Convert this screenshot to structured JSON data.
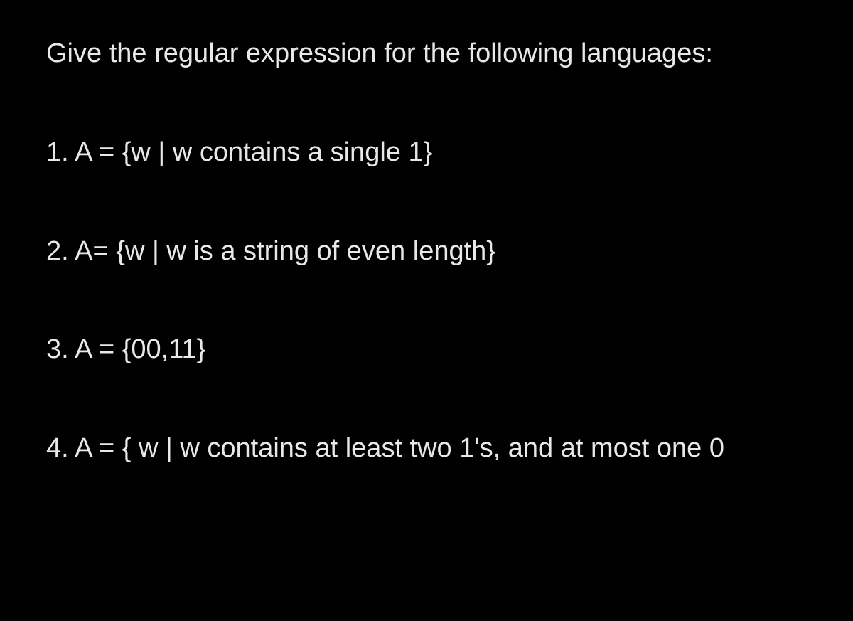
{
  "intro": "Give the regular expression for the following languages:",
  "items": [
    "1. A = {w | w contains a single 1}",
    "2. A= {w | w is a string of even length}",
    "3. A = {00,11}",
    "4. A = { w | w contains at least two 1's, and at most one 0"
  ]
}
